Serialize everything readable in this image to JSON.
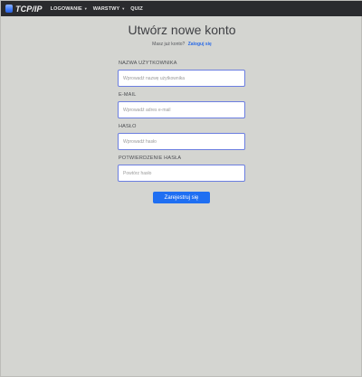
{
  "navbar": {
    "brand": "TCP/IP",
    "items": [
      {
        "label": "LOGOWANIE",
        "has_dropdown": true
      },
      {
        "label": "WARSTWY",
        "has_dropdown": true
      },
      {
        "label": "QUIZ",
        "has_dropdown": false
      }
    ]
  },
  "form": {
    "title": "Utwórz nowe konto",
    "subtitle_text": "Masz już konto?",
    "subtitle_link": "Zaloguj się",
    "fields": [
      {
        "label": "NAZWA UŻYTKOWNIKA",
        "placeholder": "Wprowadź nazwę użytkownika",
        "value": ""
      },
      {
        "label": "E-MAIL",
        "placeholder": "Wprowadź adres e-mail",
        "value": ""
      },
      {
        "label": "HASŁO",
        "placeholder": "Wprowadź hasło",
        "value": ""
      },
      {
        "label": "POTWIERDZENIE HASŁA",
        "placeholder": "Powtórz hasło",
        "value": ""
      }
    ],
    "submit_label": "Zarejestruj się"
  },
  "colors": {
    "navbar_bg": "#2a2b2e",
    "page_bg": "#d4d5d1",
    "accent": "#1f6ff2",
    "input_border": "#6b7ee0"
  }
}
